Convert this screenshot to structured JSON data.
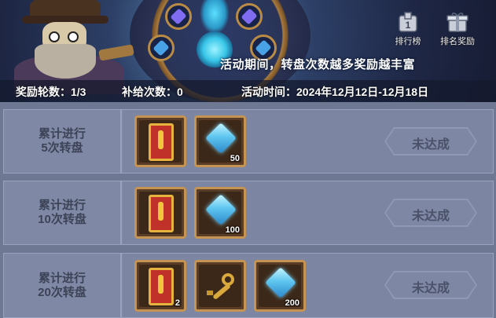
{
  "banner": {
    "slogan": "活动期间，转盘次数越多奖励越丰富",
    "buttons": [
      {
        "label": "排行榜",
        "icon": "ranking-icon"
      },
      {
        "label": "排名奖励",
        "icon": "gift-icon"
      }
    ]
  },
  "info": {
    "reward_rounds": "奖励轮数：1/3",
    "supply_count": "补给次数：0",
    "event_time": "活动时间：2024年12月12日-12月18日"
  },
  "rows": [
    {
      "label_line1": "累计进行",
      "label_line2": "5次转盘",
      "items": [
        {
          "icon": "red-card-icon",
          "qty": ""
        },
        {
          "icon": "diamond-icon",
          "qty": "50"
        }
      ],
      "status": "未达成"
    },
    {
      "label_line1": "累计进行",
      "label_line2": "10次转盘",
      "items": [
        {
          "icon": "red-card-icon",
          "qty": ""
        },
        {
          "icon": "diamond-icon",
          "qty": "100"
        }
      ],
      "status": "未达成"
    },
    {
      "label_line1": "累计进行",
      "label_line2": "20次转盘",
      "items": [
        {
          "icon": "red-card-icon",
          "qty": "2"
        },
        {
          "icon": "key-icon",
          "qty": ""
        },
        {
          "icon": "diamond-icon",
          "qty": "200"
        }
      ],
      "status": "未达成"
    }
  ],
  "colors": {
    "background": "#6f7893",
    "row_bg": "#7f89a6",
    "item_border": "#c59352",
    "status_text": "#4a5168"
  }
}
